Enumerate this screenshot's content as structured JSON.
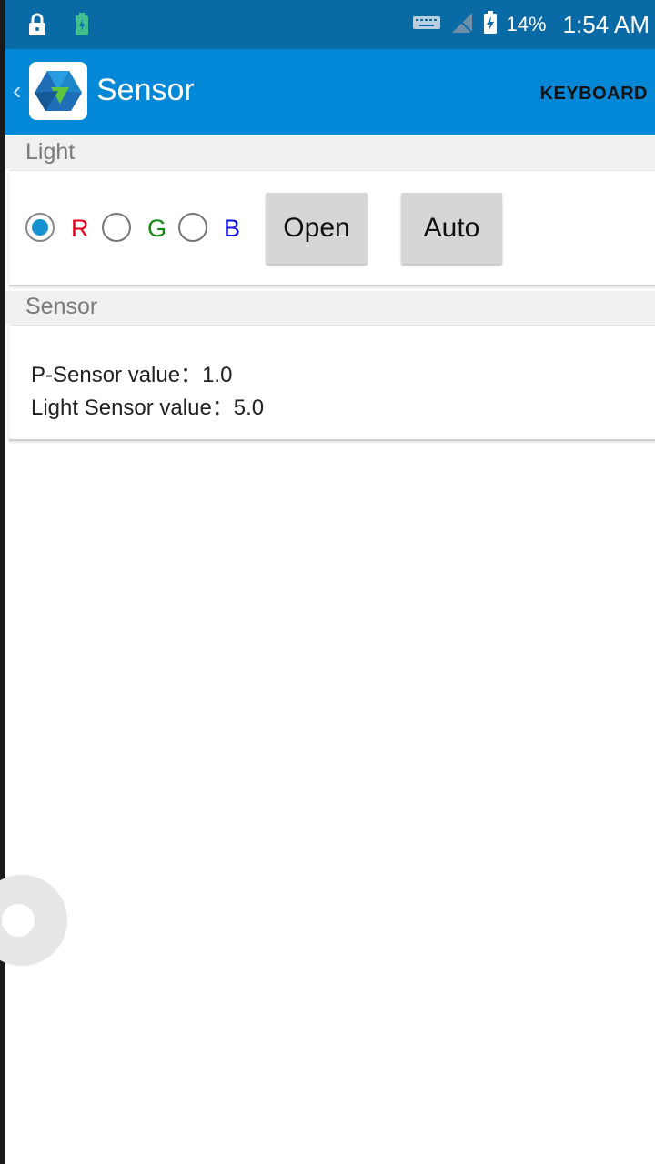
{
  "status_bar": {
    "battery_percent": "14%",
    "time": "1:54 AM",
    "icons": [
      "lock-icon",
      "battery-saver-icon",
      "keyboard-icon",
      "no-sim-icon",
      "battery-charging-icon"
    ]
  },
  "app_bar": {
    "title": "Sensor",
    "action_label": "KEYBOARD",
    "accent_color": "#0288d6"
  },
  "light_section": {
    "header": "Light",
    "radios": [
      {
        "label": "R",
        "color": "#e8001c",
        "checked": true
      },
      {
        "label": "G",
        "color": "#148a14",
        "checked": false
      },
      {
        "label": "B",
        "color": "#1010e0",
        "checked": false
      }
    ],
    "open_button": "Open",
    "auto_button": "Auto"
  },
  "sensor_section": {
    "header": "Sensor",
    "p_sensor": "P-Sensor value：1.0",
    "light_sensor": "Light Sensor value：5.0"
  }
}
